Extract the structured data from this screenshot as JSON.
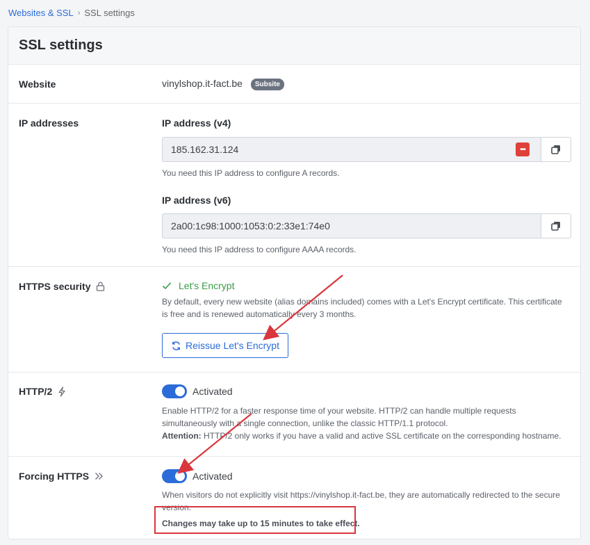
{
  "breadcrumb": {
    "parent": "Websites & SSL",
    "separator": "›",
    "current": "SSL settings"
  },
  "page_title": "SSL settings",
  "website": {
    "label": "Website",
    "value": "vinylshop.it-fact.be",
    "badge": "Subsite"
  },
  "ip": {
    "label": "IP addresses",
    "v4_label": "IP address (v4)",
    "v4_value": "185.162.31.124",
    "v4_help": "You need this IP address to configure A records.",
    "v6_label": "IP address (v6)",
    "v6_value": "2a00:1c98:1000:1053:0:2:33e1:74e0",
    "v6_help": "You need this IP address to configure AAAA records."
  },
  "https_security": {
    "label": "HTTPS security",
    "status": "Let's Encrypt",
    "description": "By default, every new website (alias domains included) comes with a Let's Encrypt certificate. This certificate is free and is renewed automatically every 3 months.",
    "button_label": "Reissue Let's Encrypt"
  },
  "http2": {
    "label": "HTTP/2",
    "toggle_label": "Activated",
    "enabled": true,
    "description": "Enable HTTP/2 for a faster response time of your website. HTTP/2 can handle multiple requests simultaneously with a single connection, unlike the classic HTTP/1.1 protocol.",
    "attention_label": "Attention:",
    "attention_text": " HTTP/2 only works if you have a valid and active SSL certificate on the corresponding hostname."
  },
  "forcing_https": {
    "label": "Forcing HTTPS",
    "toggle_label": "Activated",
    "enabled": true,
    "description": "When visitors do not explicitly visit https://vinylshop.it-fact.be, they are automatically redirected to the secure version.",
    "note": "Changes may take up to 15 minutes to take effect."
  },
  "colors": {
    "accent": "#2b6cd8",
    "success": "#3b9b48",
    "annotation": "#d9363e"
  }
}
